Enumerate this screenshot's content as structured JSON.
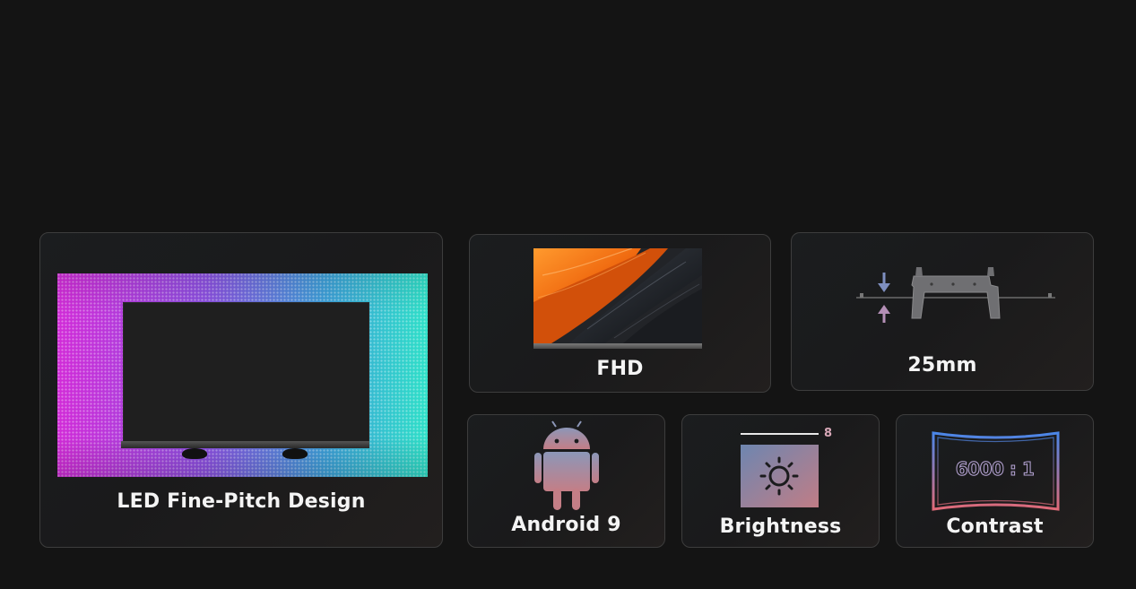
{
  "cards": {
    "led": {
      "label": "LED Fine-Pitch Design"
    },
    "fhd": {
      "label": "FHD"
    },
    "thickness": {
      "label": "25mm"
    },
    "android": {
      "label": "Android 9"
    },
    "brightness": {
      "label": "Brightness",
      "level_label": "8"
    },
    "contrast": {
      "label": "Contrast",
      "ratio_text": "6000 : 1"
    }
  },
  "colors": {
    "background": "#141414",
    "card_border": "#3d3d3d",
    "led_magenta": "#d12bd8",
    "led_cyan": "#2ee0c8",
    "feather_orange": "#f06a10",
    "contrast_blue": "#4a86e8",
    "contrast_red": "#e06a78"
  },
  "icons": {
    "led": "led-wall-tv-icon",
    "fhd": "feather-screen-icon",
    "thickness": "wall-mount-bracket-icon",
    "android": "android-robot-icon",
    "brightness": "sun-icon",
    "contrast": "curved-screen-icon"
  }
}
